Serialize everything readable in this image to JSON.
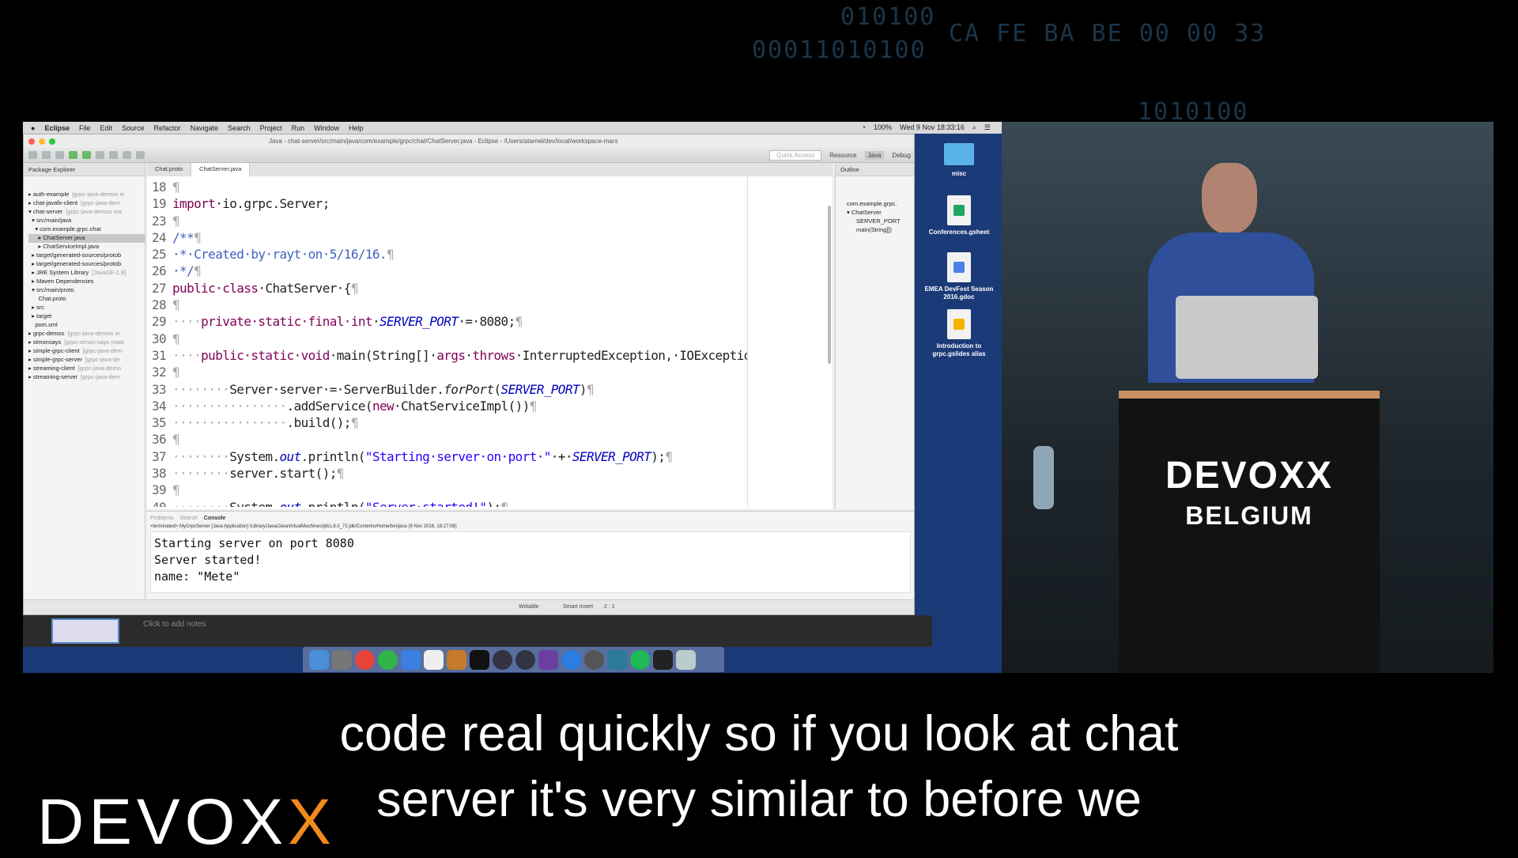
{
  "background_text": [
    "010100",
    "CA FE BA BE 00 00 33",
    "00011010100",
    "1010100"
  ],
  "menubar": {
    "apple": "",
    "app": "Eclipse",
    "items": [
      "File",
      "Edit",
      "Source",
      "Refactor",
      "Navigate",
      "Search",
      "Project",
      "Run",
      "Window",
      "Help"
    ],
    "battery": "100%",
    "clock": "Wed 9 Nov 18:33:16"
  },
  "window": {
    "title": "Java - chat-server/src/main/java/com/example/grpc/chat/ChatServer.java - Eclipse - /Users/atamel/dev/local/workspace-mars",
    "quick_access": "Quick Access",
    "perspectives": [
      "Resource",
      "Java",
      "Debug"
    ]
  },
  "package_explorer": {
    "title": "Package Explorer",
    "items": [
      {
        "label": "▸ auth-example",
        "extra": "[grpc-java-demos m"
      },
      {
        "label": "▸ chat-javafx-client",
        "extra": "[grpc-java-dem"
      },
      {
        "label": "▾ chat-server",
        "extra": "[grpc-java-demos ma"
      },
      {
        "label": "  ▾ src/main/java",
        "extra": ""
      },
      {
        "label": "    ▾ com.example.grpc.chat",
        "extra": ""
      },
      {
        "label": "      ▸ ChatServer.java",
        "extra": "",
        "selected": true
      },
      {
        "label": "      ▸ ChatServiceImpl.java",
        "extra": ""
      },
      {
        "label": "  ▸ target/generated-sources/protob",
        "extra": ""
      },
      {
        "label": "  ▸ target/generated-sources/protob",
        "extra": ""
      },
      {
        "label": "  ▸ JRE System Library",
        "extra": "[JavaSE-1.8]"
      },
      {
        "label": "  ▸ Maven Dependencies",
        "extra": ""
      },
      {
        "label": "  ▾ src/main/proto",
        "extra": ""
      },
      {
        "label": "      Chat.proto",
        "extra": ""
      },
      {
        "label": "  ▸ src",
        "extra": ""
      },
      {
        "label": "  ▸ target",
        "extra": ""
      },
      {
        "label": "    pom.xml",
        "extra": ""
      },
      {
        "label": "▸ grpc-demos",
        "extra": "[grpc-java-demos m"
      },
      {
        "label": "▸ simonsays",
        "extra": "[grpc-simon-says mast"
      },
      {
        "label": "▸ simple-grpc-client",
        "extra": "[grpc-java-dem"
      },
      {
        "label": "▸ simple-grpc-server",
        "extra": "[grpc-java-de"
      },
      {
        "label": "▸ streaming-client",
        "extra": "[grpc-java-demo"
      },
      {
        "label": "▸ streaming-server",
        "extra": "[grpc-java-dem"
      }
    ]
  },
  "editor": {
    "tabs": [
      "Chat.proto",
      "ChatServer.java"
    ],
    "lines": [
      {
        "n": "18",
        "t": [
          [
            "pm",
            "¶"
          ]
        ]
      },
      {
        "n": "19",
        "t": [
          [
            "kw",
            "import"
          ],
          [
            "",
            "·io.grpc.Server;"
          ]
        ]
      },
      {
        "n": "23",
        "t": [
          [
            "pm",
            "¶"
          ]
        ]
      },
      {
        "n": "24",
        "t": [
          [
            "cm",
            "/**"
          ],
          [
            "pm",
            "¶"
          ]
        ]
      },
      {
        "n": "25",
        "t": [
          [
            "cm",
            "·*·Created·by·rayt·on·5/16/16."
          ],
          [
            "pm",
            "¶"
          ]
        ]
      },
      {
        "n": "26",
        "t": [
          [
            "cm",
            "·*/"
          ],
          [
            "pm",
            "¶"
          ]
        ]
      },
      {
        "n": "27",
        "t": [
          [
            "kw",
            "public·class"
          ],
          [
            "",
            "·ChatServer·{"
          ],
          [
            "pm",
            "¶"
          ]
        ]
      },
      {
        "n": "28",
        "t": [
          [
            "pm",
            "¶"
          ]
        ]
      },
      {
        "n": "29",
        "t": [
          [
            "pm",
            "····"
          ],
          [
            "kw",
            "private·static·final·int"
          ],
          [
            "",
            "·"
          ],
          [
            "fd",
            "SERVER_PORT"
          ],
          [
            "",
            "·=·8080;"
          ],
          [
            "pm",
            "¶"
          ]
        ]
      },
      {
        "n": "30",
        "t": [
          [
            "pm",
            "¶"
          ]
        ]
      },
      {
        "n": "31",
        "t": [
          [
            "pm",
            "····"
          ],
          [
            "kw",
            "public·static·void"
          ],
          [
            "",
            "·main(String[]·"
          ],
          [
            "kw",
            "args"
          ],
          [
            "",
            "·"
          ],
          [
            "kw",
            "throws"
          ],
          [
            "",
            "·InterruptedException,·IOException·{"
          ],
          [
            "pm",
            "¶"
          ]
        ]
      },
      {
        "n": "32",
        "t": [
          [
            "pm",
            "¶"
          ]
        ]
      },
      {
        "n": "33",
        "t": [
          [
            "pm",
            "········"
          ],
          [
            "",
            "Server·server·=·ServerBuilder."
          ],
          [
            "it",
            "forPort"
          ],
          [
            "",
            "("
          ],
          [
            "fd",
            "SERVER_PORT"
          ],
          [
            "",
            ")"
          ],
          [
            "pm",
            "¶"
          ]
        ]
      },
      {
        "n": "34",
        "t": [
          [
            "pm",
            "················"
          ],
          [
            "",
            ".addService("
          ],
          [
            "kw",
            "new"
          ],
          [
            "",
            "·ChatServiceImpl())"
          ],
          [
            "pm",
            "¶"
          ]
        ]
      },
      {
        "n": "35",
        "t": [
          [
            "pm",
            "················"
          ],
          [
            "",
            ".build();"
          ],
          [
            "pm",
            "¶"
          ]
        ]
      },
      {
        "n": "36",
        "t": [
          [
            "pm",
            "¶"
          ]
        ]
      },
      {
        "n": "37",
        "t": [
          [
            "pm",
            "········"
          ],
          [
            "",
            "System."
          ],
          [
            "fd",
            "out"
          ],
          [
            "",
            ".println("
          ],
          [
            "st",
            "\"Starting·server·on·port·\""
          ],
          [
            "",
            "·+·"
          ],
          [
            "fd",
            "SERVER_PORT"
          ],
          [
            "",
            ");"
          ],
          [
            "pm",
            "¶"
          ]
        ]
      },
      {
        "n": "38",
        "t": [
          [
            "pm",
            "········"
          ],
          [
            "",
            "server.start();"
          ],
          [
            "pm",
            "¶"
          ]
        ]
      },
      {
        "n": "39",
        "t": [
          [
            "pm",
            "¶"
          ]
        ]
      },
      {
        "n": "40",
        "t": [
          [
            "pm",
            "········"
          ],
          [
            "",
            "System."
          ],
          [
            "fd",
            "out"
          ],
          [
            "",
            ".println("
          ],
          [
            "st",
            "\"Server·started!\""
          ],
          [
            "",
            ");"
          ],
          [
            "pm",
            "¶"
          ]
        ]
      }
    ]
  },
  "outline": {
    "title": "Outline",
    "items": [
      "com.example.grpc.",
      "▾ ChatServer",
      "SERVER_PORT",
      "main(String[])"
    ]
  },
  "console": {
    "tabs": [
      "Problems",
      "Search",
      "Console"
    ],
    "terminated": "<terminated> MyGrpcServer [Java Application] /Library/Java/JavaVirtualMachines/jdk1.8.0_72.jdk/Contents/Home/bin/java (9 Nov 2016, 18:27:08)",
    "output": [
      "Starting server on port 8080",
      "Server started!",
      "name: \"Mete\""
    ]
  },
  "status": {
    "writable": "Writable",
    "insert": "Smart Insert",
    "position": "2 : 1"
  },
  "notes": {
    "placeholder": "Click to add notes"
  },
  "desktop": {
    "icons": [
      "misc",
      "Conferences.gsheet",
      "EMEA DevFest Season 2016.gdoc",
      "Introduction to grpc.gslides alias"
    ]
  },
  "stage": {
    "podium_line1": "DEVOXX",
    "podium_line2": "BELGIUM"
  },
  "subtitles": [
    "code real quickly so if you look at chat",
    "server it's very similar to before we"
  ],
  "logo": {
    "text": "DEVOXX"
  }
}
